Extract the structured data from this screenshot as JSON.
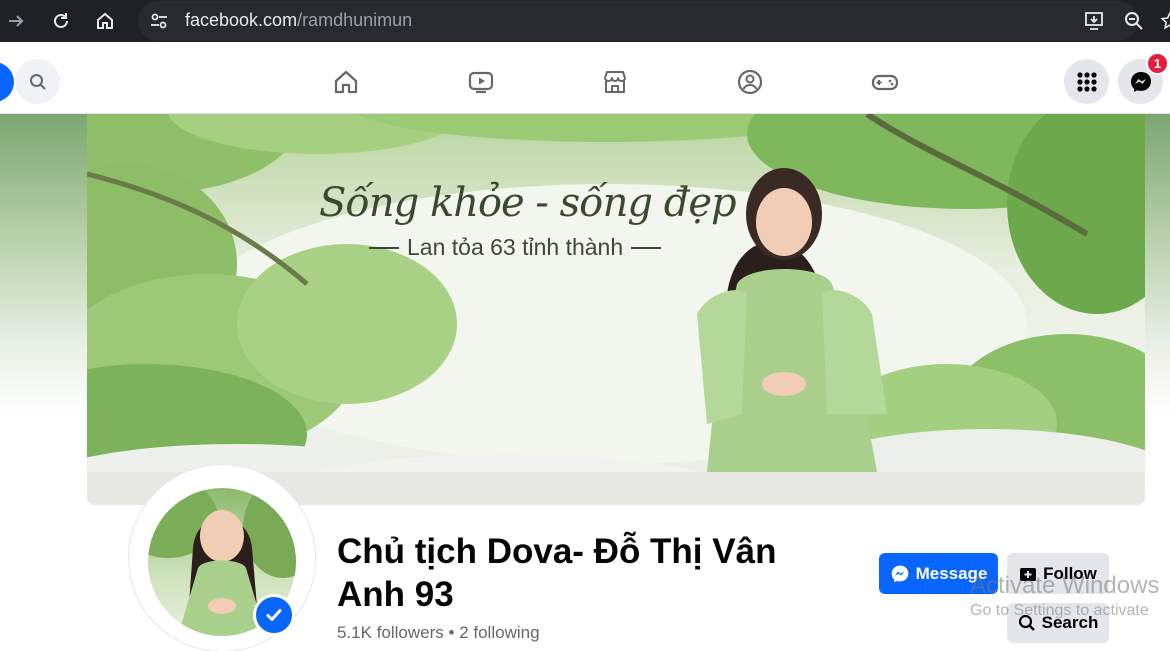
{
  "browser": {
    "url_domain": "facebook.com",
    "url_path": "/ramdhunimun"
  },
  "nav": {
    "messenger_badge": "1",
    "tabs": [
      "home-icon",
      "video-icon",
      "marketplace-icon",
      "groups-icon",
      "gaming-icon"
    ]
  },
  "cover": {
    "title": "Sống khỏe - sống đẹp",
    "subtitle": "Lan tỏa 63 tỉnh thành"
  },
  "profile": {
    "name": "Chủ tịch Dova- Đỗ Thị Vân Anh 93",
    "followers": "5.1K followers",
    "separator": "•",
    "following": "2 following"
  },
  "actions": {
    "message": "Message",
    "follow": "Follow",
    "search": "Search"
  },
  "watermark": {
    "line1": "Activate Windows",
    "line2": "Go to Settings to activate"
  },
  "colors": {
    "fb_blue": "#0866ff",
    "badge_red": "#e41e3f",
    "button_gray": "#e4e6eb"
  }
}
